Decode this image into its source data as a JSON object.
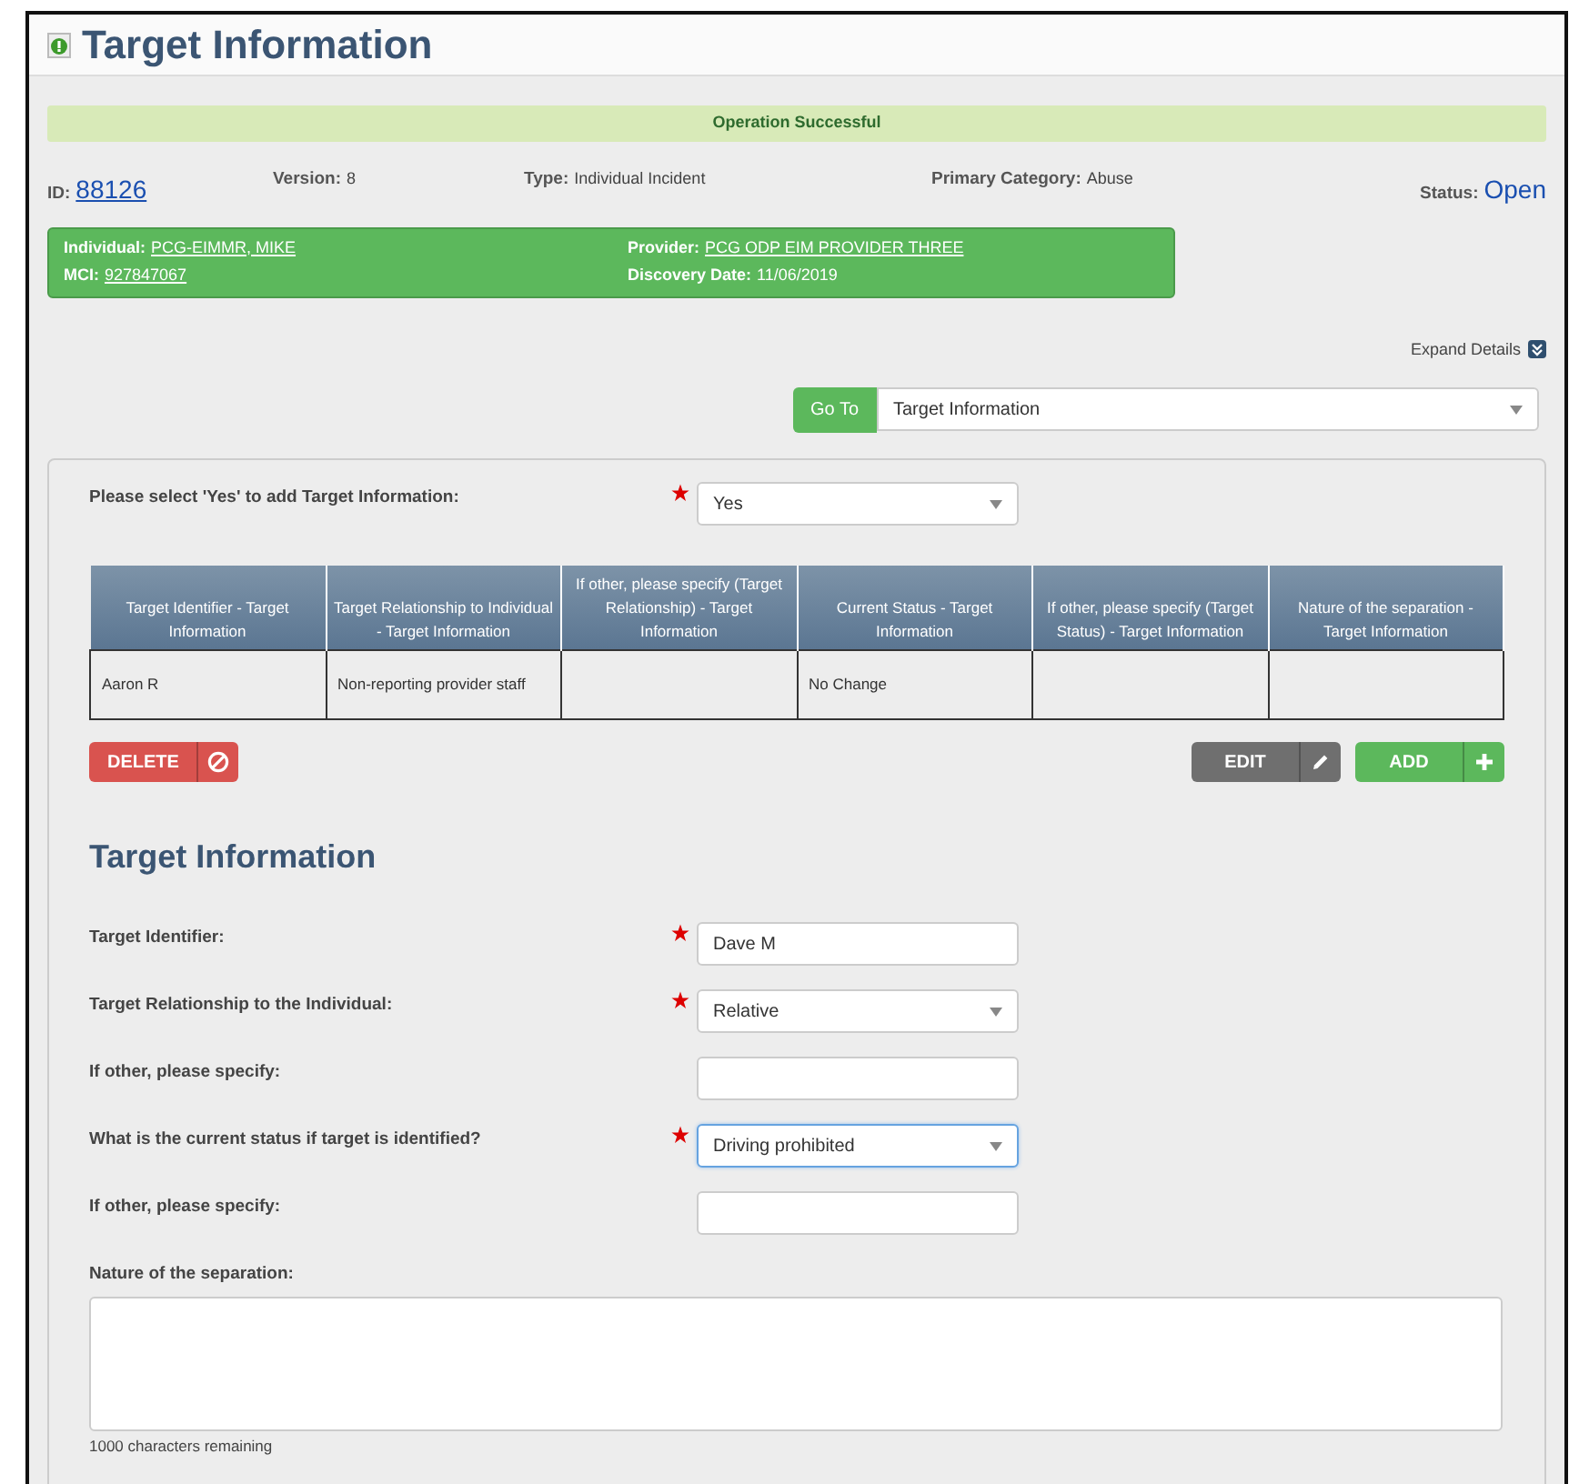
{
  "page": {
    "title": "Target Information"
  },
  "alert": "Operation Successful",
  "summary": [
    {
      "label": "ID:",
      "value": "88126",
      "kind": "link"
    },
    {
      "label": "Version:",
      "value": "8",
      "kind": "text"
    },
    {
      "label": "Type:",
      "value": "Individual Incident",
      "kind": "text"
    },
    {
      "label": "Primary Category:",
      "value": "Abuse",
      "kind": "text"
    },
    {
      "label": "Status:",
      "value": "Open",
      "kind": "status"
    }
  ],
  "individual_box": [
    {
      "label": "Individual:",
      "value": "PCG-EIMMR, MIKE",
      "link": true
    },
    {
      "label": "Provider:",
      "value": "PCG ODP EIM PROVIDER THREE",
      "link": true
    },
    {
      "label": "MCI:",
      "value": "927847067",
      "link": true
    },
    {
      "label": "Discovery Date:",
      "value": "11/06/2019",
      "link": false
    }
  ],
  "expand_details": "Expand Details",
  "goto": {
    "button": "Go To",
    "value": "Target Information"
  },
  "add_question": {
    "label": "Please select 'Yes' to add Target Information:",
    "required": true,
    "value": "Yes"
  },
  "table": {
    "columns": [
      "Target Identifier - Target Information",
      "Target Relationship to Individual - Target Information",
      "If other, please specify (Target Relationship) - Target Information",
      "Current Status - Target Information",
      "If other, please specify (Target Status) - Target Information",
      "Nature of the separation - Target Information"
    ],
    "rows": [
      [
        "Aaron R",
        "Non-reporting provider staff",
        null,
        "No Change",
        null,
        null
      ]
    ]
  },
  "buttons": [
    {
      "label": "DELETE",
      "kind": "delete"
    },
    {
      "label": "EDIT",
      "kind": "edit"
    },
    {
      "label": "ADD",
      "kind": "add"
    }
  ],
  "section_title": "Target Information",
  "fields": [
    {
      "label": "Target Identifier:",
      "kind": "input",
      "required": true,
      "value": "Dave M",
      "focused": false
    },
    {
      "label": "Target Relationship to the Individual:",
      "kind": "select",
      "required": true,
      "value": "Relative",
      "focused": false
    },
    {
      "label": "If other, please specify:",
      "kind": "input",
      "required": false,
      "focused": false
    },
    {
      "label": "What is the current status if target is identified?",
      "kind": "select",
      "required": true,
      "value": "Driving prohibited",
      "focused": true
    },
    {
      "label": "If other, please specify:",
      "kind": "input",
      "required": false,
      "focused": false
    }
  ],
  "textarea": {
    "label": "Nature of the separation:",
    "counter": "1000 characters remaining"
  }
}
